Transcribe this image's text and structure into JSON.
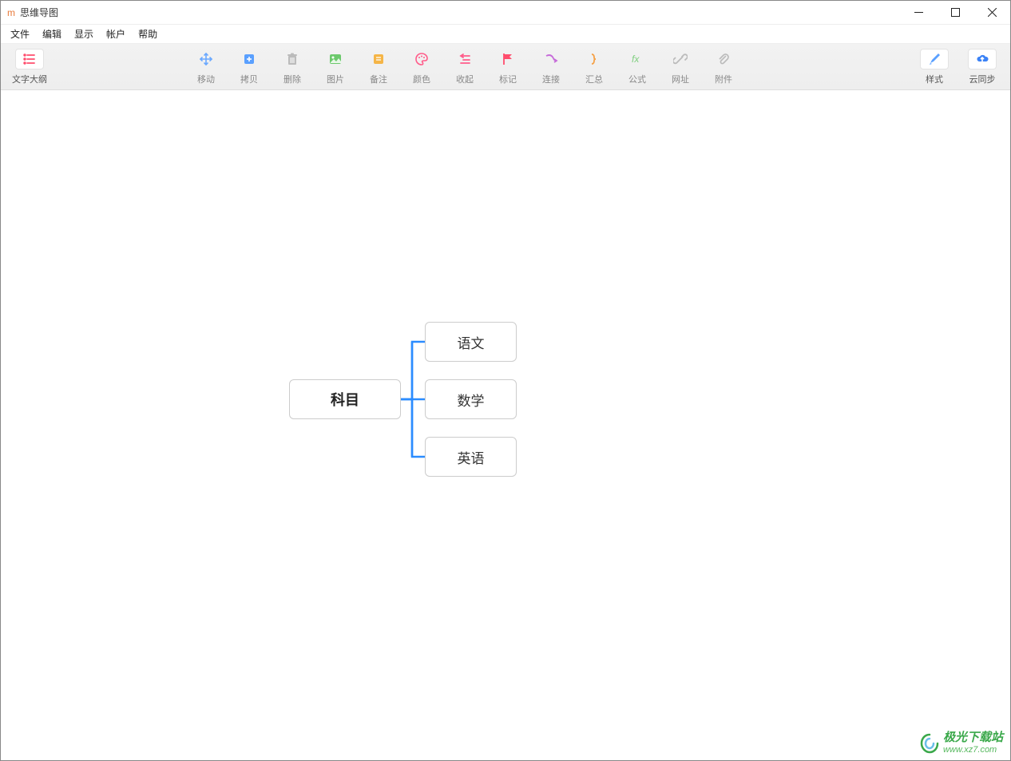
{
  "window": {
    "app_icon": "m",
    "title": "思维导图"
  },
  "menu": {
    "file": "文件",
    "edit": "编辑",
    "view": "显示",
    "account": "帐户",
    "help": "帮助"
  },
  "toolbar": {
    "outline": "文字大纲",
    "move": "移动",
    "copy": "拷贝",
    "delete": "删除",
    "image": "图片",
    "note": "备注",
    "color": "颜色",
    "collapse": "收起",
    "flag": "标记",
    "connect": "连接",
    "summary": "汇总",
    "formula": "公式",
    "url": "网址",
    "attach": "附件",
    "style": "样式",
    "sync": "云同步"
  },
  "mindmap": {
    "root": "科目",
    "children": [
      "语文",
      "数学",
      "英语"
    ]
  },
  "watermark": {
    "name": "极光下载站",
    "url": "www.xz7.com"
  }
}
